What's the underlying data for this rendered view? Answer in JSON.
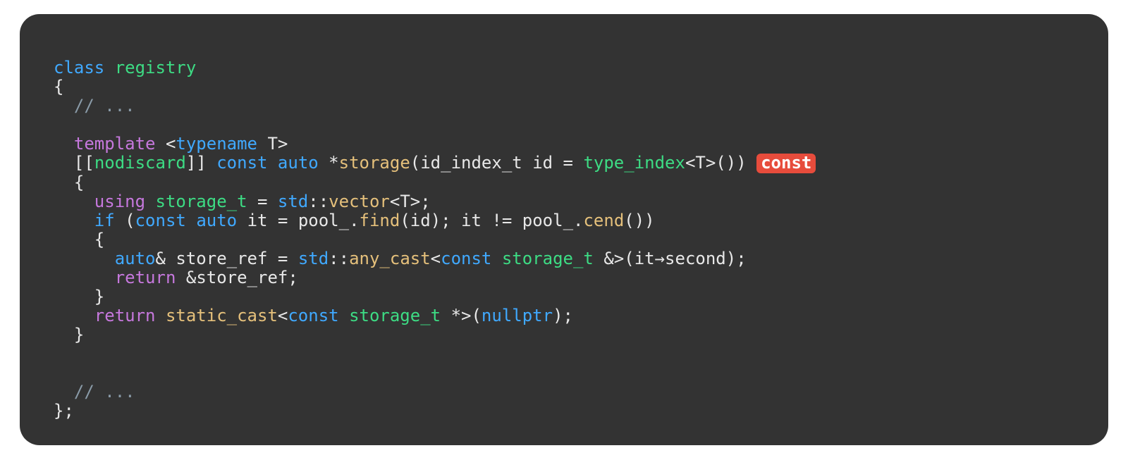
{
  "code": {
    "l1_class": "class",
    "l1_registry": "registry",
    "l2_brace": "{",
    "l3_comment": "  // ...",
    "l5_template_kw": "template",
    "l5_typename_kw": "typename",
    "l5_T": "T",
    "l6_nodiscard": "nodiscard",
    "l6_const1": "const",
    "l6_auto": "auto",
    "l6_storage_fn": "storage",
    "l6_id_index_t": "id_index_t",
    "l6_id": "id",
    "l6_type_index": "type_index",
    "l6_T2": "T",
    "l6_const_badge": "const",
    "l7_brace": "{",
    "l8_using": "using",
    "l8_storage_t": "storage_t",
    "l8_std": "std",
    "l8_vector": "vector",
    "l8_T": "T",
    "l9_if": "if",
    "l9_const": "const",
    "l9_auto": "auto",
    "l9_it": "it",
    "l9_pool1": "pool_",
    "l9_find": "find",
    "l9_id": "id",
    "l9_it2": "it",
    "l9_ne": "!=",
    "l9_pool2": "pool_",
    "l9_cend": "cend",
    "l10_brace": "{",
    "l11_auto": "auto",
    "l11_amp": "&",
    "l11_store_ref": "store_ref",
    "l11_std": "std",
    "l11_any_cast": "any_cast",
    "l11_const": "const",
    "l11_storage_t": "storage_t",
    "l11_it": "it",
    "l11_arrow": "→",
    "l11_second": "second",
    "l12_return": "return",
    "l12_amp": "&",
    "l12_store_ref": "store_ref",
    "l13_brace": "}",
    "l14_return": "return",
    "l14_static_cast": "static_cast",
    "l14_const": "const",
    "l14_storage_t": "storage_t",
    "l14_nullptr": "nullptr",
    "l15_brace": "}",
    "l17_comment": "  // ...",
    "l18_close": "};"
  },
  "colors": {
    "background": "#333333",
    "badge": "#e74c3c"
  }
}
